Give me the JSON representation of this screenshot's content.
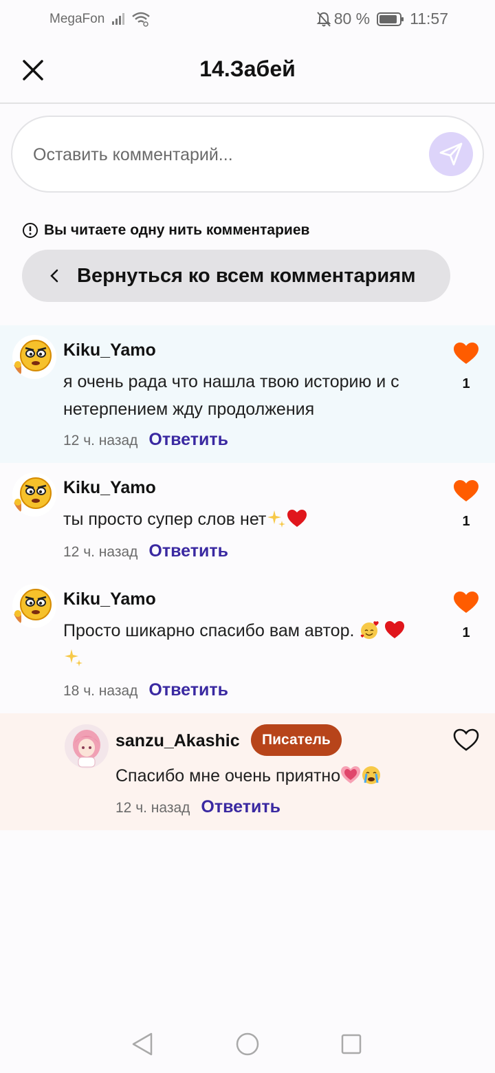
{
  "status": {
    "carrier": "MegaFon",
    "battery": "80 %",
    "time": "11:57"
  },
  "header": {
    "title": "14.Забей"
  },
  "comment_input": {
    "placeholder": "Оставить комментарий..."
  },
  "thread": {
    "notice": "Вы читаете одну нить комментариев",
    "back_label": "Вернуться ко всем комментариям"
  },
  "comments": [
    {
      "username": "Kiku_Yamo",
      "text": "я очень рада что нашла твою историю и с нетерпением жду продолжения",
      "time": "12 ч. назад",
      "reply": "Ответить",
      "likes": "1",
      "liked": true
    },
    {
      "username": "Kiku_Yamo",
      "text": "ты просто супер слов нет",
      "time": "12 ч. назад",
      "reply": "Ответить",
      "likes": "1",
      "liked": true
    },
    {
      "username": "Kiku_Yamo",
      "text": "Просто шикарно спасибо вам автор.",
      "time": "18 ч. назад",
      "reply": "Ответить",
      "likes": "1",
      "liked": true
    },
    {
      "username": "sanzu_Akashic",
      "badge": "Писатель",
      "text": "Спасибо мне очень приятно",
      "time": "12 ч. назад",
      "reply": "Ответить",
      "liked": false
    }
  ],
  "colors": {
    "accent": "#3a29a1",
    "heart": "#ff5c00",
    "badge": "#b7441a",
    "highlight": "#f2f9fc",
    "author_bg": "#fdf3ef"
  }
}
